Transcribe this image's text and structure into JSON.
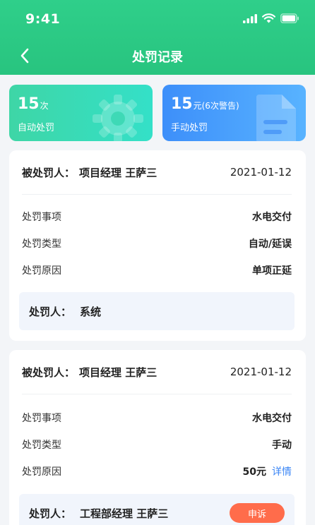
{
  "status_bar": {
    "time": "9:41"
  },
  "nav": {
    "title": "处罚记录"
  },
  "stats": {
    "auto": {
      "number": "15",
      "unit": "次",
      "label": "自动处罚"
    },
    "manual": {
      "number": "15",
      "unit": "元(6次警告)",
      "label": "手动处罚"
    }
  },
  "records": [
    {
      "punished_label": "被处罚人：",
      "punished_name": "项目经理 王萨三",
      "date": "2021-01-12",
      "rows": [
        {
          "label": "处罚事项",
          "value": "水电交付"
        },
        {
          "label": "处罚类型",
          "value": "自动/延误"
        },
        {
          "label": "处罚原因",
          "value": "单项正延"
        }
      ],
      "punisher_label": "处罚人：",
      "punisher_name": "系统"
    },
    {
      "punished_label": "被处罚人：",
      "punished_name": "项目经理 王萨三",
      "date": "2021-01-12",
      "rows": [
        {
          "label": "处罚事项",
          "value": "水电交付"
        },
        {
          "label": "处罚类型",
          "value": "手动"
        },
        {
          "label": "处罚原因",
          "value": "50元",
          "link": "详情"
        }
      ],
      "punisher_label": "处罚人：",
      "punisher_name": "工程部经理 王萨三",
      "action": "申诉"
    }
  ],
  "colors": {
    "header_green": "#2fcf8a",
    "auto_card": "#3ed6a6",
    "manual_card": "#3d8ffa",
    "link_blue": "#3b86f5",
    "appeal_orange": "#ff6c4b"
  },
  "icons": [
    "signal-icon",
    "wifi-icon",
    "battery-icon",
    "back-arrow-icon",
    "gear-icon",
    "document-icon"
  ]
}
